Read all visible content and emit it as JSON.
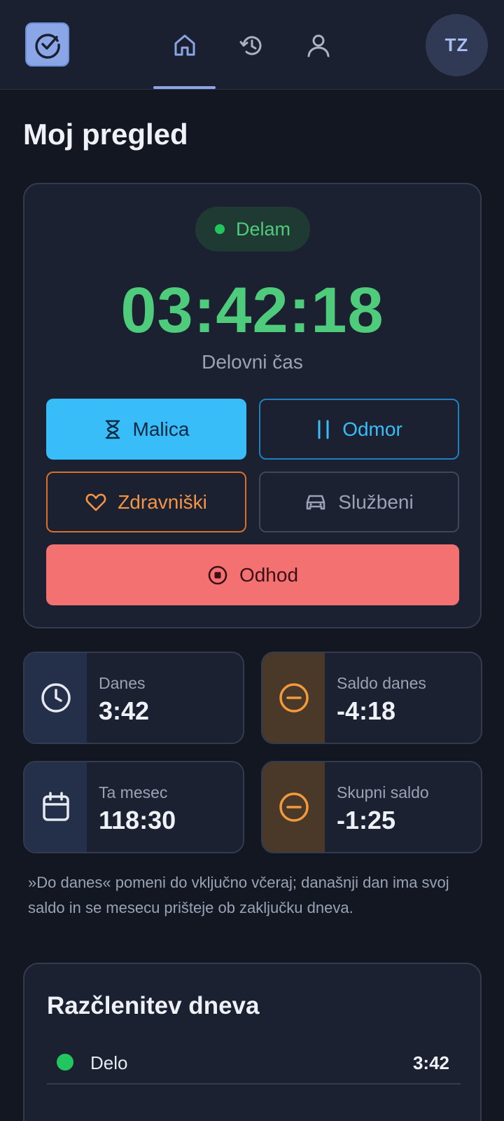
{
  "header": {
    "avatar_initials": "TZ",
    "logo_icon": "clock-check-icon",
    "nav": [
      {
        "icon": "home-icon",
        "active": true
      },
      {
        "icon": "history-icon",
        "active": false
      },
      {
        "icon": "user-icon",
        "active": false
      }
    ]
  },
  "page": {
    "title": "Moj pregled"
  },
  "timer": {
    "status": "Delam",
    "value": "03:42:18",
    "label": "Delovni čas",
    "buttons": {
      "malica": "Malica",
      "odmor": "Odmor",
      "zdravniski": "Zdravniški",
      "sluzbeni": "Službeni",
      "odhod": "Odhod"
    }
  },
  "stats": [
    {
      "label": "Danes",
      "value": "3:42",
      "icon": "clock-icon"
    },
    {
      "label": "Saldo danes",
      "value": "-4:18",
      "icon": "minus-circle-icon"
    },
    {
      "label": "Ta mesec",
      "value": "118:30",
      "icon": "calendar-icon"
    },
    {
      "label": "Skupni saldo",
      "value": "-1:25",
      "icon": "minus-circle-icon"
    }
  ],
  "note": "»Do danes« pomeni do vključno včeraj; današnji dan ima svoj saldo in se mesecu prišteje ob zaključku dneva.",
  "breakdown": {
    "title": "Razčlenitev dneva",
    "rows": [
      {
        "label": "Delo",
        "value": "3:42"
      }
    ]
  },
  "colors": {
    "background": "#131722",
    "accent": "#8aa6e6",
    "working_green": "#4ecb7b",
    "malica_blue": "#38bdf8",
    "zdravniski_orange": "#f59445",
    "odhod_red": "#f47171"
  }
}
